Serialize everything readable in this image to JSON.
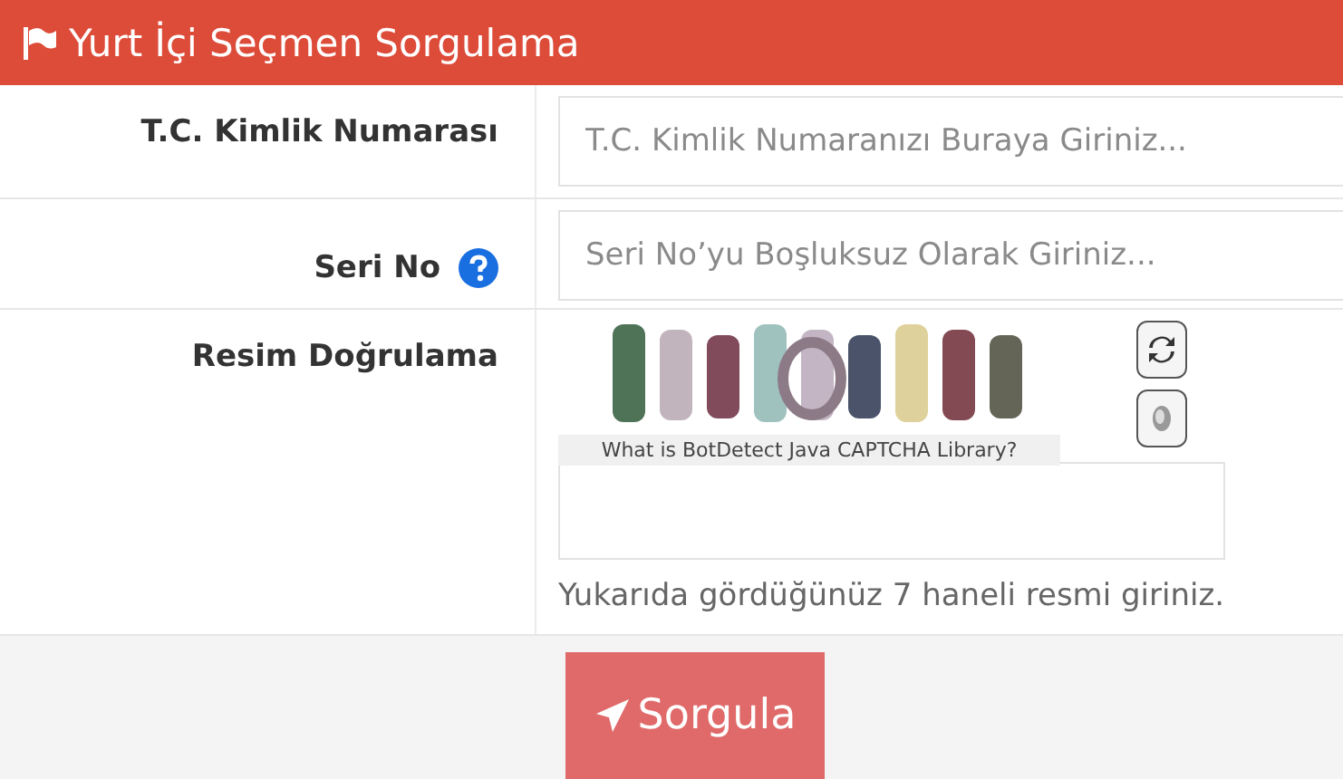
{
  "header": {
    "title": "Yurt İçi Seçmen Sorgulama"
  },
  "fields": [
    {
      "kind": "text",
      "label": "T.C. Kimlik Numarası",
      "placeholder": "T.C. Kimlik Numaranızı Buraya Giriniz...",
      "help": false
    },
    {
      "kind": "text",
      "label": "Seri No",
      "placeholder": "Seri No’yu Boşluksuz Olarak Giriniz...",
      "help": true
    },
    {
      "kind": "captcha",
      "label": "Resim Doğrulama",
      "captcha": {
        "kind": "picture",
        "link": "What is BotDetect Java CAPTCHA Library?"
      },
      "hint": "Yukarıda gördüğünüz 7 haneli resmi giriniz."
    }
  ],
  "submit": {
    "label": "Sorgula"
  }
}
